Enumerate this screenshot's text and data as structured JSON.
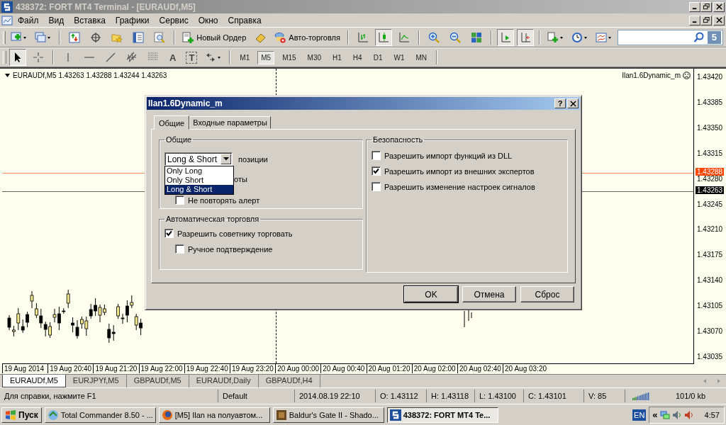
{
  "window": {
    "title": "438372: FORT MT4 Terminal - [EURAUDf,M5]"
  },
  "menu": [
    "Файл",
    "Вид",
    "Вставка",
    "Графики",
    "Сервис",
    "Окно",
    "Справка"
  ],
  "toolbar": {
    "new_order": "Новый Ордер",
    "auto_trading": "Авто-торговля",
    "community_badge": "5"
  },
  "drawing_tools": {
    "text_tool": "A",
    "text_label_tool": "T"
  },
  "timeframes": [
    {
      "label": "M1",
      "selected": false
    },
    {
      "label": "M5",
      "selected": true
    },
    {
      "label": "M15",
      "selected": false
    },
    {
      "label": "M30",
      "selected": false
    },
    {
      "label": "H1",
      "selected": false
    },
    {
      "label": "H4",
      "selected": false
    },
    {
      "label": "D1",
      "selected": false
    },
    {
      "label": "W1",
      "selected": false
    },
    {
      "label": "MN",
      "selected": false
    }
  ],
  "chart": {
    "header": "EURAUDf,M5 1.43263 1.43288 1.43244 1.43263",
    "expert": "Ilan1.6Dynamic_m",
    "price_labels": [
      "1.43420",
      "1.43385",
      "1.43350",
      "1.43315",
      "1.43280",
      "1.43245",
      "1.43210",
      "1.43175",
      "1.43140",
      "1.43105",
      "1.43070",
      "1.43035"
    ],
    "price_lines": [
      {
        "label": "1.43288",
        "color": "#ff4500"
      },
      {
        "label": "1.43263",
        "color": "#000000"
      }
    ],
    "time_labels": [
      "19 Aug 2014",
      "19 Aug 20:40",
      "19 Aug 21:20",
      "19 Aug 22:00",
      "19 Aug 22:40",
      "19 Aug 23:20",
      "20 Aug 00:00",
      "20 Aug 00:40",
      "20 Aug 01:20",
      "20 Aug 02:00",
      "20 Aug 02:40",
      "20 Aug 03:20"
    ]
  },
  "chart_tabs": [
    {
      "label": "EURAUDf,M5",
      "selected": true
    },
    {
      "label": "EURJPYf,M5",
      "selected": false
    },
    {
      "label": "GBPAUDf,M5",
      "selected": false
    },
    {
      "label": "EURAUDf,Daily",
      "selected": false
    },
    {
      "label": "GBPAUDf,H4",
      "selected": false
    }
  ],
  "status_bar": [
    "Для справки, нажмите F1",
    "Default",
    "2014.08.19 22:10",
    "O: 1.43112",
    "H: 1.43118",
    "L: 1.43100",
    "C: 1.43101",
    "V: 85",
    "101/0 kb"
  ],
  "taskbar": {
    "start": "Пуск",
    "tasks": [
      {
        "label": "Total Commander 8.50 - ...",
        "selected": false
      },
      {
        "label": "[M5] Ilan на полуавтом...",
        "selected": false
      },
      {
        "label": "Baldur's Gate II - Shado...",
        "selected": false
      },
      {
        "label": "438372: FORT MT4 Te...",
        "selected": true
      }
    ],
    "language": "EN",
    "tray_expand": "«",
    "clock": "4:57"
  },
  "dialog": {
    "title": "Ilan1.6Dynamic_m",
    "help": "?",
    "tabs": [
      {
        "label": "Общие",
        "selected": true
      },
      {
        "label": "Входные параметры",
        "selected": false
      }
    ],
    "common": {
      "title": "Общие",
      "positions": {
        "value": "Long & Short",
        "label": "позиции",
        "expanded": true,
        "options": [
          {
            "label": "Only Long",
            "selected": false
          },
          {
            "label": "Only Short",
            "selected": false
          },
          {
            "label": "Long & Short",
            "selected": true
          }
        ]
      },
      "obscured_label": "оты",
      "no_repeat_alert": {
        "label": "Не повторять алерт",
        "checked": false
      }
    },
    "auto_trading": {
      "title": "Автоматическая торговля",
      "allow": {
        "label": "Разрешить советнику торговать",
        "checked": true,
        "children": [
          {
            "label": "Ручное подтверждение",
            "checked": false
          }
        ]
      }
    },
    "security": {
      "title": "Безопасность",
      "options": [
        {
          "label": "Разрешить импорт функций из DLL",
          "checked": false
        },
        {
          "label": "Разрешить импорт из внешних экспертов",
          "checked": true
        },
        {
          "label": "Разрешить изменение настроек сигналов",
          "checked": false
        }
      ]
    },
    "buttons": [
      "OK",
      "Отмена",
      "Сброс"
    ]
  }
}
